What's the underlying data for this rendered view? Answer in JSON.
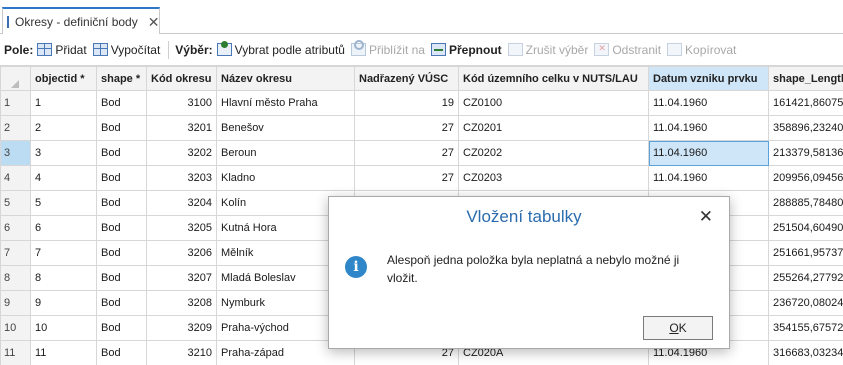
{
  "tab": {
    "title": "Okresy - definiční body",
    "close": "✕"
  },
  "toolbar": {
    "pole_label": "Pole:",
    "add_label": "Přidat",
    "calc_label": "Vypočítat",
    "vyber_label": "Výběr:",
    "select_by_attr_label": "Vybrat podle atributů",
    "zoom_label": "Přiblížit na",
    "switch_label": "Přepnout",
    "clear_label": "Zrušit výběr",
    "delete_label": "Odstranit",
    "copy_label": "Kopírovat"
  },
  "table": {
    "columns": [
      "objectid *",
      "shape *",
      "Kód okresu",
      "Název okresu",
      "Nadřazený VÚSC",
      "Kód územního celku v NUTS/LAU",
      "Datum vzniku prvku",
      "shape_Length"
    ],
    "selected_column": "Datum vzniku prvku",
    "selected_row": "3",
    "rows": [
      {
        "n": "1",
        "objectid": "1",
        "shape": "Bod",
        "kod": "3100",
        "nazev": "Hlavní město Praha",
        "vusc": "19",
        "nuts": "CZ0100",
        "datum": "11.04.1960",
        "length": "161421,86075"
      },
      {
        "n": "2",
        "objectid": "2",
        "shape": "Bod",
        "kod": "3201",
        "nazev": "Benešov",
        "vusc": "27",
        "nuts": "CZ0201",
        "datum": "11.04.1960",
        "length": "358896,23240"
      },
      {
        "n": "3",
        "objectid": "3",
        "shape": "Bod",
        "kod": "3202",
        "nazev": "Beroun",
        "vusc": "27",
        "nuts": "CZ0202",
        "datum": "11.04.1960",
        "length": "213379,58136"
      },
      {
        "n": "4",
        "objectid": "4",
        "shape": "Bod",
        "kod": "3203",
        "nazev": "Kladno",
        "vusc": "27",
        "nuts": "CZ0203",
        "datum": "11.04.1960",
        "length": "209956,09456"
      },
      {
        "n": "5",
        "objectid": "5",
        "shape": "Bod",
        "kod": "3204",
        "nazev": "Kolín",
        "vusc": "",
        "nuts": "",
        "datum": "",
        "length": "288885,78480"
      },
      {
        "n": "6",
        "objectid": "6",
        "shape": "Bod",
        "kod": "3205",
        "nazev": "Kutná Hora",
        "vusc": "",
        "nuts": "",
        "datum": "",
        "length": "251504,60490"
      },
      {
        "n": "7",
        "objectid": "7",
        "shape": "Bod",
        "kod": "3206",
        "nazev": "Mělník",
        "vusc": "",
        "nuts": "",
        "datum": "",
        "length": "251661,95737"
      },
      {
        "n": "8",
        "objectid": "8",
        "shape": "Bod",
        "kod": "3207",
        "nazev": "Mladá Boleslav",
        "vusc": "",
        "nuts": "",
        "datum": "",
        "length": "255264,27792"
      },
      {
        "n": "9",
        "objectid": "9",
        "shape": "Bod",
        "kod": "3208",
        "nazev": "Nymburk",
        "vusc": "",
        "nuts": "",
        "datum": "",
        "length": "236720,08024"
      },
      {
        "n": "10",
        "objectid": "10",
        "shape": "Bod",
        "kod": "3209",
        "nazev": "Praha-východ",
        "vusc": "",
        "nuts": "",
        "datum": "",
        "length": "354155,67572"
      },
      {
        "n": "11",
        "objectid": "11",
        "shape": "Bod",
        "kod": "3210",
        "nazev": "Praha-západ",
        "vusc": "27",
        "nuts": "CZ020A",
        "datum": "11.04.1960",
        "length": "316683,03234"
      }
    ]
  },
  "dialog": {
    "title": "Vložení tabulky",
    "close": "✕",
    "message": "Alespoň jedna položka byla neplatná a nebylo možné ji vložit.",
    "ok_accel": "O",
    "ok_rest": "K",
    "info_glyph": "i"
  }
}
